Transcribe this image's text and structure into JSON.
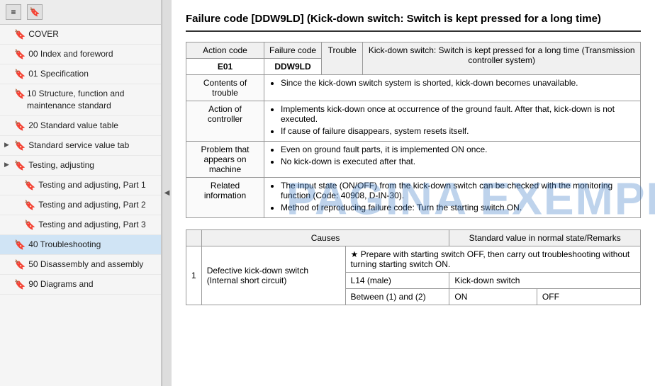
{
  "sidebar": {
    "toolbar": {
      "icon1": "≡",
      "icon2": "🔖"
    },
    "items": [
      {
        "id": "cover",
        "label": "COVER",
        "hasArrow": false,
        "indent": false
      },
      {
        "id": "00-index",
        "label": "00 Index and foreword",
        "hasArrow": false,
        "indent": false
      },
      {
        "id": "01-spec",
        "label": "01 Specification",
        "hasArrow": false,
        "indent": false
      },
      {
        "id": "10-structure",
        "label": "10 Structure, function and maintenance standard",
        "hasArrow": false,
        "indent": false
      },
      {
        "id": "20-standard",
        "label": "20 Standard value table",
        "hasArrow": false,
        "indent": false
      },
      {
        "id": "std-service",
        "label": "Standard service value tab",
        "hasArrow": true,
        "indent": false
      },
      {
        "id": "testing-adj",
        "label": "Testing, adjusting",
        "hasArrow": true,
        "indent": false
      },
      {
        "id": "testing-adj-1",
        "label": "Testing and adjusting, Part 1",
        "hasArrow": false,
        "indent": true
      },
      {
        "id": "testing-adj-2",
        "label": "Testing and adjusting, Part 2",
        "hasArrow": false,
        "indent": true
      },
      {
        "id": "testing-adj-3",
        "label": "Testing and adjusting, Part 3",
        "hasArrow": false,
        "indent": true
      },
      {
        "id": "40-trouble",
        "label": "40 Troubleshooting",
        "hasArrow": false,
        "indent": false,
        "active": true
      },
      {
        "id": "50-disassembly",
        "label": "50 Disassembly and assembly",
        "hasArrow": false,
        "indent": false
      },
      {
        "id": "90-diagrams",
        "label": "90 Diagrams and",
        "hasArrow": false,
        "indent": false
      }
    ]
  },
  "main": {
    "title": "Failure code [DDW9LD] (Kick-down switch: Switch is kept pressed for a long time)",
    "table1": {
      "headers": [
        "Action code",
        "Failure code",
        "Trouble"
      ],
      "action_code": "E01",
      "failure_code": "DDW9LD",
      "trouble_desc": "Kick-down switch: Switch is kept pressed for a long time (Transmission controller system)",
      "rows": [
        {
          "header": "Contents of trouble",
          "content": "Since the kick-down switch system is shorted, kick-down becomes unavailable."
        },
        {
          "header": "Action of controller",
          "content1": "Implements kick-down once at occurrence of the ground fault. After that, kick-down is not executed.",
          "content2": "If cause of failure disappears, system resets itself."
        },
        {
          "header": "Problem that appears on machine",
          "content1": "Even on ground fault parts, it is implemented ON once.",
          "content2": "No kick-down is executed after that."
        },
        {
          "header": "Related information",
          "content1": "The input state (ON/OFF) from the kick-down switch can be checked with the monitoring function (Code: 40908, D-IN-30).",
          "content2": "Method of reproducing failure code: Turn the starting switch ON."
        }
      ]
    },
    "table2": {
      "header_causes": "Causes",
      "header_standard": "Standard value in normal state/Remarks",
      "row_number": "1",
      "cause_label": "Defective kick-down switch (Internal short circuit)",
      "prepare_note": "★ Prepare with starting switch OFF, then carry out troubleshooting without turning starting switch ON.",
      "sub_rows": [
        {
          "connector": "L14 (male)",
          "part": "Kick-down switch"
        },
        {
          "between": "Between (1) and (2)",
          "on_state": "ON",
          "off_state": "OFF"
        }
      ]
    }
  },
  "watermark": "PAGINA EXEMPLU"
}
